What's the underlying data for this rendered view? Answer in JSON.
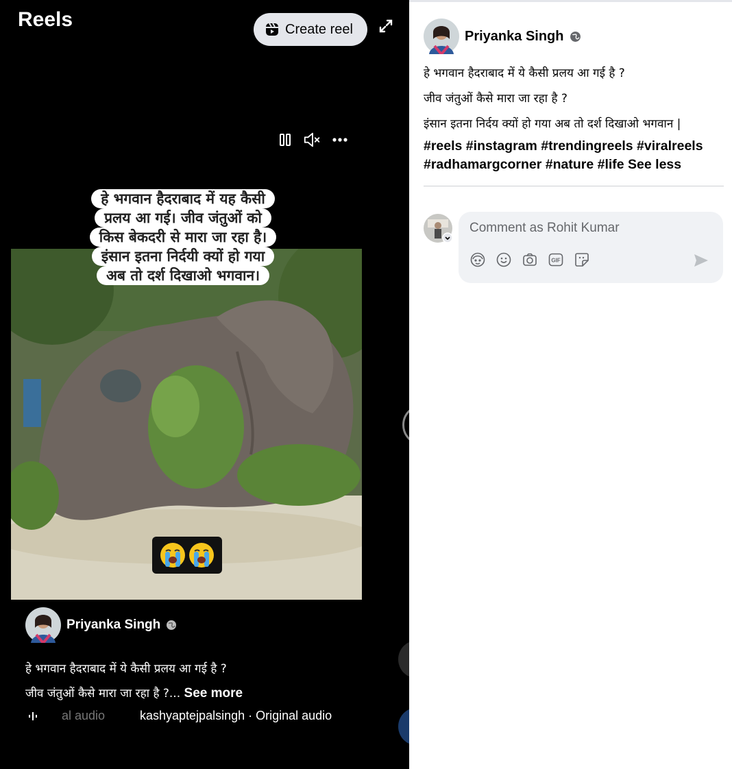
{
  "player": {
    "title": "Reels",
    "create_reel_label": "Create reel",
    "video_overlay_caption": [
      "हे भगवान हैदराबाद में यह कैसी",
      "प्रलय आ गई। जीव जंतुओं को",
      "किस बेकदरी से मारा जा रहा है।",
      "इंसान इतना निर्दयी क्यों हो गया",
      "अब तो दर्श दिखाओ भगवान।"
    ],
    "author_name": "Priyanka Singh",
    "description_line1": "हे भगवान हैदराबाद में ये कैसी प्रलय आ गई है ?",
    "description_line2": "जीव जंतुओं कैसे मारा जा रहा है ?...",
    "see_more_label": "See more",
    "audio_fade_text": "al audio",
    "audio_track": "kashyaptejpalsingh · Original audio"
  },
  "post": {
    "author_name": "Priyanka Singh",
    "lines": [
      "हे भगवान हैदराबाद में ये कैसी प्रलय आ गई है ?",
      "जीव जंतुओं कैसे मारा जा रहा है ?",
      "इंसान इतना निर्दय क्यों हो गया अब तो दर्श दिखाओ भगवान |"
    ],
    "hashtags": "#reels #instagram #trendingreels #viralreels #radhamargcorner #nature #life",
    "see_less_label": "See less"
  },
  "comment": {
    "placeholder": "Comment as Rohit Kumar"
  },
  "icons": {
    "globe": "globe-icon",
    "create_reel": "reel-icon",
    "expand": "expand-icon",
    "pause": "pause-icon",
    "mute": "volume-muted-icon",
    "more": "more-icon",
    "avatar_sticker": "avatar-sticker-icon",
    "emoji": "emoji-icon",
    "camera": "camera-icon",
    "gif": "gif-icon",
    "sticker": "sticker-icon",
    "send": "send-icon"
  },
  "colors": {
    "player_bg": "#000000",
    "panel_bg": "#ffffff",
    "comment_bg": "#f0f2f5",
    "button_bg": "#e4e6eb",
    "text_primary": "#050505",
    "text_secondary": "#65676b"
  }
}
